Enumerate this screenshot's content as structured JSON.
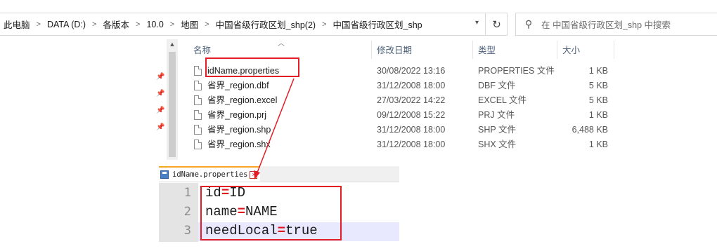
{
  "breadcrumb": {
    "items": [
      "此电脑",
      "DATA (D:)",
      "各版本",
      "10.0",
      "地图",
      "中国省级行政区划_shp(2)",
      "中国省级行政区划_shp"
    ],
    "separator": ">"
  },
  "refresh_icon": "refresh-icon",
  "search": {
    "placeholder": "在 中国省级行政区划_shp 中搜索"
  },
  "columns": {
    "name": "名称",
    "date": "修改日期",
    "type": "类型",
    "size": "大小"
  },
  "files": [
    {
      "name": "idName.properties",
      "date": "30/08/2022 13:16",
      "type": "PROPERTIES 文件",
      "size": "1 KB"
    },
    {
      "name": "省界_region.dbf",
      "date": "31/12/2008 18:00",
      "type": "DBF 文件",
      "size": "5 KB"
    },
    {
      "name": "省界_region.excel",
      "date": "27/03/2022 14:22",
      "type": "EXCEL 文件",
      "size": "5 KB"
    },
    {
      "name": "省界_region.prj",
      "date": "09/12/2008 15:22",
      "type": "PRJ 文件",
      "size": "1 KB"
    },
    {
      "name": "省界_region.shp",
      "date": "31/12/2008 18:00",
      "type": "SHP 文件",
      "size": "6,488 KB"
    },
    {
      "name": "省界_region.shx",
      "date": "31/12/2008 18:00",
      "type": "SHX 文件",
      "size": "1 KB"
    }
  ],
  "editor": {
    "tab_name": "idName.properties",
    "lines": [
      {
        "num": "1",
        "key": "id",
        "eq": "=",
        "value": "ID"
      },
      {
        "num": "2",
        "key": "name",
        "eq": "=",
        "value": "NAME"
      },
      {
        "num": "3",
        "key": "needLocal",
        "eq": "=",
        "value": "true"
      }
    ]
  },
  "colors": {
    "annotation": "#e41e26",
    "tab_accent": "#f5a623",
    "equals": "#e0141e"
  }
}
